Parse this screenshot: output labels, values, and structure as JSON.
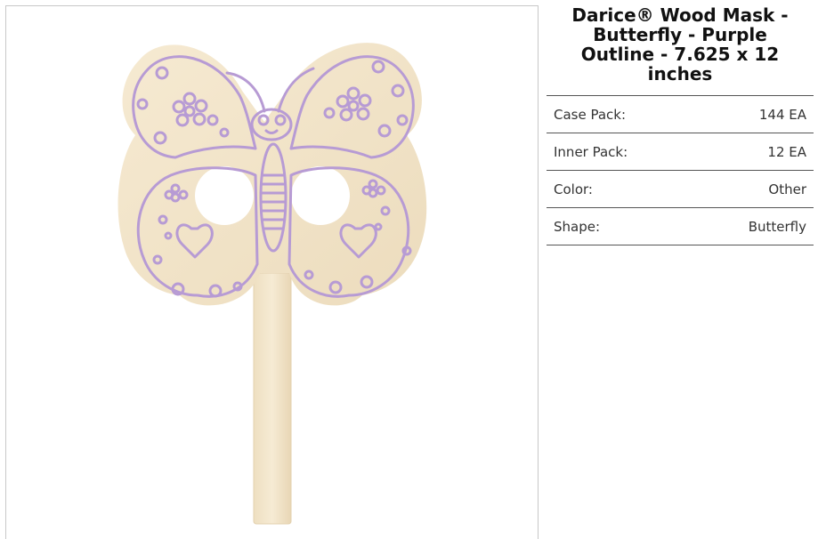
{
  "product": {
    "title": "Darice® Wood Mask -\nButterfly - Purple\nOutline - 7.625 x 12\ninches",
    "image_icon": "butterfly-wood-mask-image",
    "colors": {
      "wood": "#f2e4c9",
      "outline": "#b79bd4",
      "border": "#c8c8c8"
    }
  },
  "specs": [
    {
      "label": "Case Pack:",
      "value": "144 EA"
    },
    {
      "label": "Inner Pack:",
      "value": "12 EA"
    },
    {
      "label": "Color:",
      "value": "Other"
    },
    {
      "label": "Shape:",
      "value": "Butterfly"
    }
  ]
}
